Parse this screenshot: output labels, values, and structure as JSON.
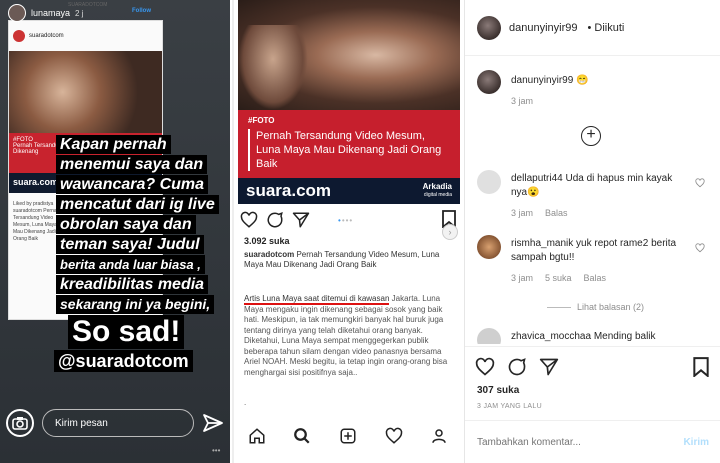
{
  "story": {
    "username": "lunamaya",
    "time": "2 j",
    "follow": "Follow",
    "source_label": "SUARADOTCOM",
    "card": {
      "account": "suaradotcom",
      "band_tag": "#FOTO",
      "band_text": "Pernah Tersandung Video Mesum, Luna Maya Mau Dikenang",
      "logo": "suara.com",
      "liked_by": "Liked by pradistya",
      "mini_caption": "suaradotcom Pernah Tersandung Video Mesum, Luna Maya Mau Dikenang Jadi Orang Baik"
    },
    "caption_lines": [
      "Kapan pernah",
      "menemui saya dan",
      "wawancara? Cuma",
      "mencatut dari ig live",
      "obrolan saya dan",
      "teman saya! Judul",
      "berita anda luar biasa ,",
      "kreadibilitas media",
      "sekarang ini ya begini,"
    ],
    "big_text": "So sad!",
    "handle_text": "@suaradotcom",
    "message_placeholder": "Kirim pesan"
  },
  "post": {
    "band_tag": "#FOTO",
    "headline_1": "Pernah Tersandung Video Mesum,",
    "headline_2": "Luna Maya Mau Dikenang Jadi Orang Baik",
    "brand": "suara.com",
    "partner": "Arkadia",
    "partner_sub": "digital media",
    "likes": "3.092 suka",
    "caption_user": "suaradotcom",
    "caption_text": " Pernah Tersandung Video Mesum, Luna Maya Mau Dikenang Jadi Orang Baik",
    "article_underlined": "Artis Luna Maya saat ditemui di kawasan",
    "article_rest": " Jakarta. Luna Maya mengaku ingin dikenang sebagai sosok yang baik hati. Meskipun, ia tak memungkiri banyak hal buruk juga tentang dirinya yang telah diketahui orang banyak. Diketahui, Luna Maya sempat menggegerkan publik beberapa tahun silam dengan video panasnya bersama Ariel NOAH. Meski begitu, ia tetap ingin orang-orang bisa menghargai sisi positifnya saja..",
    "trailing_dot": "."
  },
  "panel": {
    "owner": "danunyinyir99",
    "status": "Diikuti",
    "owner_comment": {
      "user": "danunyinyir99",
      "text": "😁",
      "time": "3 jam"
    },
    "comments": [
      {
        "user": "dellaputri44",
        "text": "Uda di hapus min kayak nya😮",
        "time": "3 jam",
        "likes": "",
        "reply": "Balas"
      },
      {
        "user": "rismha_manik",
        "text": "yuk repot rame2 berita sampah bgtu!!",
        "time": "3 jam",
        "likes": "5 suka",
        "reply": "Balas"
      },
      {
        "user": "zhavica_mocchaa",
        "text": "Mending balik",
        "time": "",
        "likes": "",
        "reply": ""
      }
    ],
    "view_replies": "Lihat balasan (2)",
    "likes": "307 suka",
    "posted": "3 JAM YANG LALU",
    "comment_placeholder": "Tambahkan komentar...",
    "post_button": "Kirim"
  }
}
